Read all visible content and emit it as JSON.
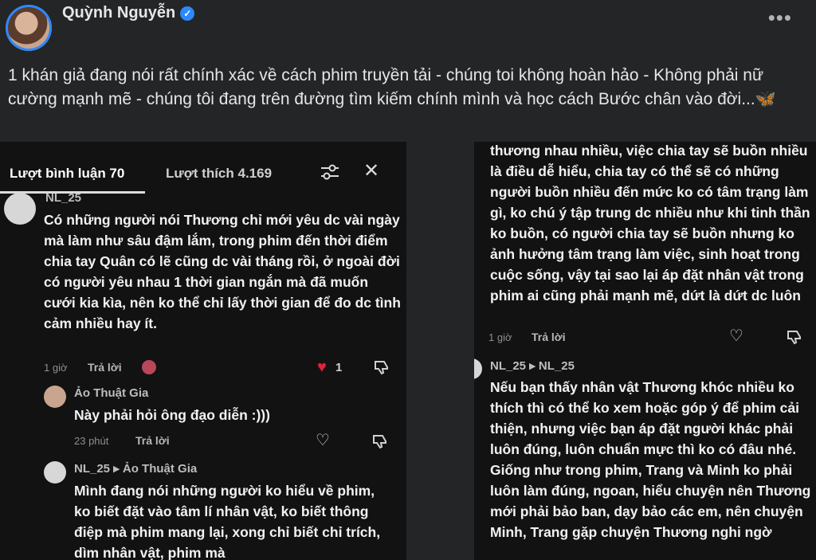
{
  "post": {
    "author": "Quỳnh Nguyễn",
    "caption": "1 khán giả đang nói rất chính xác về cách phim truyền tải - chúng toi không hoàn hảo -   Không phải nữ cường mạnh mẽ -  chúng tôi đang trên đường tìm kiếm chính mình và học cách Bước chân vào đời...",
    "caption_emoji": "🦋"
  },
  "left": {
    "tab_comments": "Lượt bình luận 70",
    "tab_likes": "Lượt thích 4.169",
    "c1": {
      "user": "NL_25",
      "text": "Có những người nói Thương chỉ mới yêu dc vài ngày mà làm như sâu đậm lắm, trong phim đến thời điểm chia tay Quân có lẽ cũng dc vài tháng rồi, ở ngoài đời có người yêu nhau 1 thời gian ngắn mà đã muốn cưới kia kìa, nên ko thể chỉ lấy thời gian để đo dc tình cảm nhiều hay ít.",
      "time": "1 giờ",
      "reply": "Trả lời",
      "likes": "1"
    },
    "c2": {
      "user": "Ảo Thuật Gia",
      "text": "Này phải hỏi ông đạo diễn :)))",
      "time": "23 phút",
      "reply": "Trả lời"
    },
    "c3": {
      "user": "NL_25 ▸ Ảo Thuật Gia",
      "text": "Mình đang nói những người ko hiểu về phim, ko biết đặt vào tâm lí nhân vật, ko biết thông điệp mà phim mang lại, xong chỉ biết chỉ trích, dìm nhân vật, phim mà"
    }
  },
  "right": {
    "c1": {
      "text": "thương nhau nhiều, việc chia tay sẽ buồn nhiều là điều dễ hiểu, chia tay có thể sẽ có những người buồn nhiều đến mức ko có tâm trạng làm gì, ko chú ý tập trung dc nhiều như khi tinh thần ko buồn, có người chia tay sẽ buồn nhưng ko ảnh hưởng tâm trạng làm việc, sinh hoạt trong cuộc sống, vậy tại sao lại áp đặt nhân vật trong phim ai cũng phải mạnh mẽ, dứt là dứt dc luôn",
      "time": "1 giờ",
      "reply": "Trả lời"
    },
    "c2": {
      "user": "NL_25 ▸ NL_25",
      "text": "Nếu bạn thấy nhân vật Thương khóc nhiều ko thích thì có thể ko xem hoặc góp ý để phim cải thiện, nhưng việc bạn áp đặt người khác phải luôn đúng, luôn chuẩn mực thì ko có đâu nhé. Giống như trong phim, Trang và Minh ko phải luôn làm đúng, ngoan, hiểu chuyện nên Thương mới phải bảo ban, dạy bảo các em, nên chuyện Minh, Trang gặp chuyện Thương nghi ngờ"
    }
  }
}
